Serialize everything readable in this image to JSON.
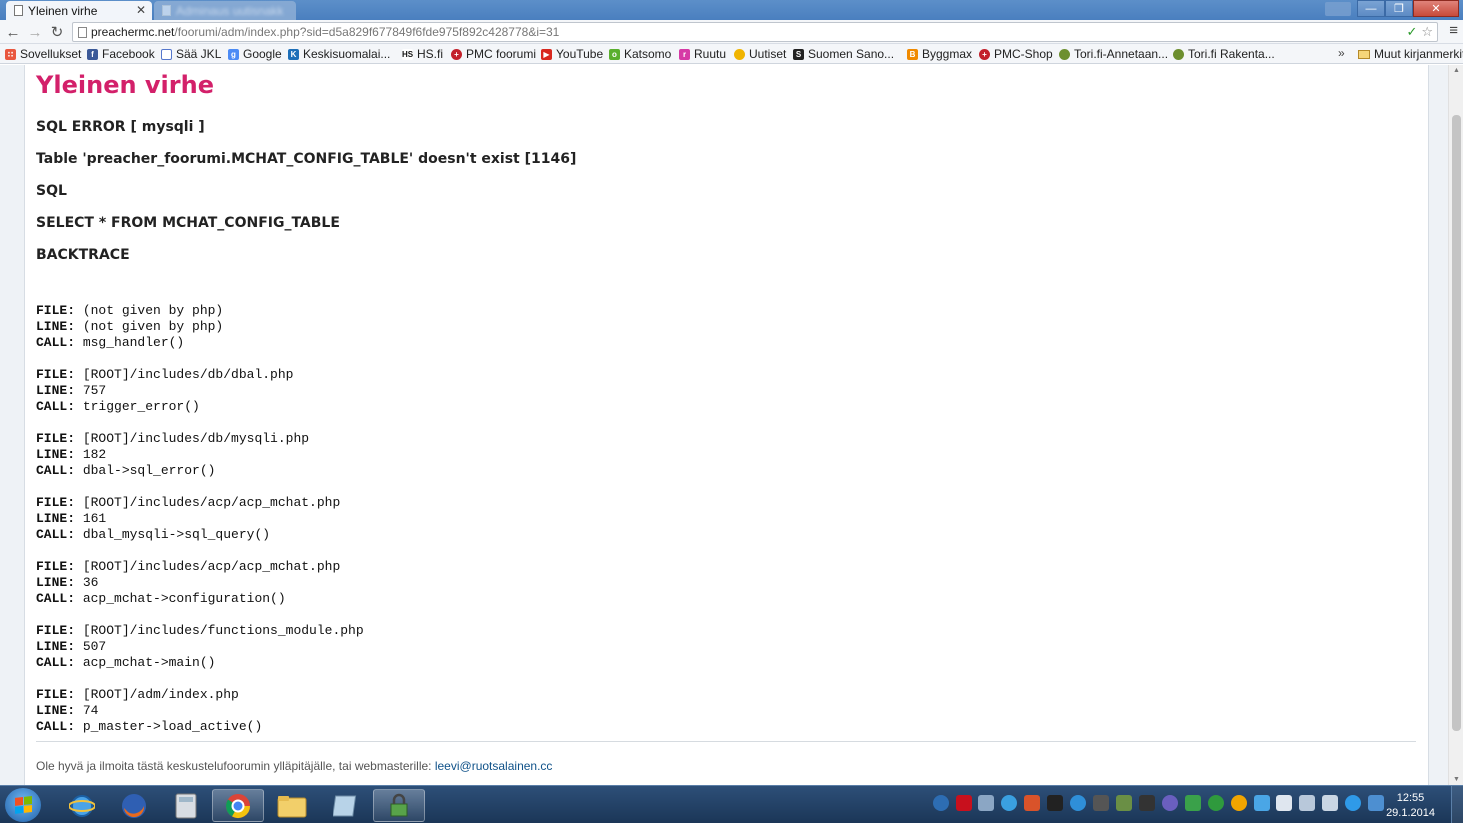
{
  "browser": {
    "active_tab_title": "Yleinen virhe",
    "tab_close_glyph": "✕",
    "inactive_tab_title": "Adminaus uutisnakk",
    "url_host": "preachermc.net",
    "url_path": "/foorumi/adm/index.php?sid=d5a829f677849f6fde975f892c428778&i=31",
    "window_buttons": {
      "minimize": "—",
      "maximize": "❐",
      "close": "✕"
    }
  },
  "bookmarks": [
    {
      "label": "Sovellukset",
      "icon": "apps-grid-icon",
      "color": "#e9573f"
    },
    {
      "label": "Facebook",
      "icon": "facebook-icon",
      "color": "#3b5998"
    },
    {
      "label": "Sää JKL",
      "icon": "weather-icon",
      "color": "#5577cc"
    },
    {
      "label": "Google",
      "icon": "google-icon",
      "color": "#4c8bf5"
    },
    {
      "label": "Keskisuomalai...",
      "icon": "k-news-icon",
      "color": "#1d6fb8"
    },
    {
      "label": "HS.fi",
      "icon": "hs-icon",
      "color": "#111111"
    },
    {
      "label": "PMC foorumi",
      "icon": "pmc-icon",
      "color": "#c3202a"
    },
    {
      "label": "YouTube",
      "icon": "youtube-icon",
      "color": "#d8281f"
    },
    {
      "label": "Katsomo",
      "icon": "katsomo-icon",
      "color": "#5aaf2e"
    },
    {
      "label": "Ruutu",
      "icon": "ruutu-icon",
      "color": "#d63aa6"
    },
    {
      "label": "Uutiset",
      "icon": "uutiset-icon",
      "color": "#f0b400"
    },
    {
      "label": "Suomen Sano...",
      "icon": "suomen-sanomat-icon",
      "color": "#222222"
    },
    {
      "label": "Byggmax",
      "icon": "byggmax-icon",
      "color": "#f08a00"
    },
    {
      "label": "PMC-Shop",
      "icon": "pmc-shop-icon",
      "color": "#c3202a"
    },
    {
      "label": "Tori.fi-Annetaan...",
      "icon": "tori-icon",
      "color": "#6d8f2f"
    },
    {
      "label": "Tori.fi Rakenta...",
      "icon": "tori-icon",
      "color": "#6d8f2f"
    }
  ],
  "bookmarks_overflow": "»",
  "other_bookmarks": "Muut kirjanmerkit",
  "page": {
    "title": "Yleinen virhe",
    "error_type": "SQL ERROR [ mysqli ]",
    "error_message": "Table 'preacher_foorumi.MCHAT_CONFIG_TABLE' doesn't exist [1146]",
    "sql_label": "SQL",
    "sql_query": "SELECT * FROM MCHAT_CONFIG_TABLE",
    "backtrace_label": "BACKTRACE",
    "backtrace": [
      {
        "file": "(not given by php)",
        "line": "(not given by php)",
        "call": "msg_handler()"
      },
      {
        "file": "[ROOT]/includes/db/dbal.php",
        "line": "757",
        "call": "trigger_error()"
      },
      {
        "file": "[ROOT]/includes/db/mysqli.php",
        "line": "182",
        "call": "dbal->sql_error()"
      },
      {
        "file": "[ROOT]/includes/acp/acp_mchat.php",
        "line": "161",
        "call": "dbal_mysqli->sql_query()"
      },
      {
        "file": "[ROOT]/includes/acp/acp_mchat.php",
        "line": "36",
        "call": "acp_mchat->configuration()"
      },
      {
        "file": "[ROOT]/includes/functions_module.php",
        "line": "507",
        "call": "acp_mchat->main()"
      },
      {
        "file": "[ROOT]/adm/index.php",
        "line": "74",
        "call": "p_master->load_active()"
      }
    ],
    "footer_text": "Ole hyvä ja ilmoita tästä keskustelufoorumin ylläpitäjälle, tai webmasterille: ",
    "footer_email": "leevi@ruotsalainen.cc"
  },
  "taskbar": {
    "time": "12:55",
    "date": "29.1.2014"
  }
}
